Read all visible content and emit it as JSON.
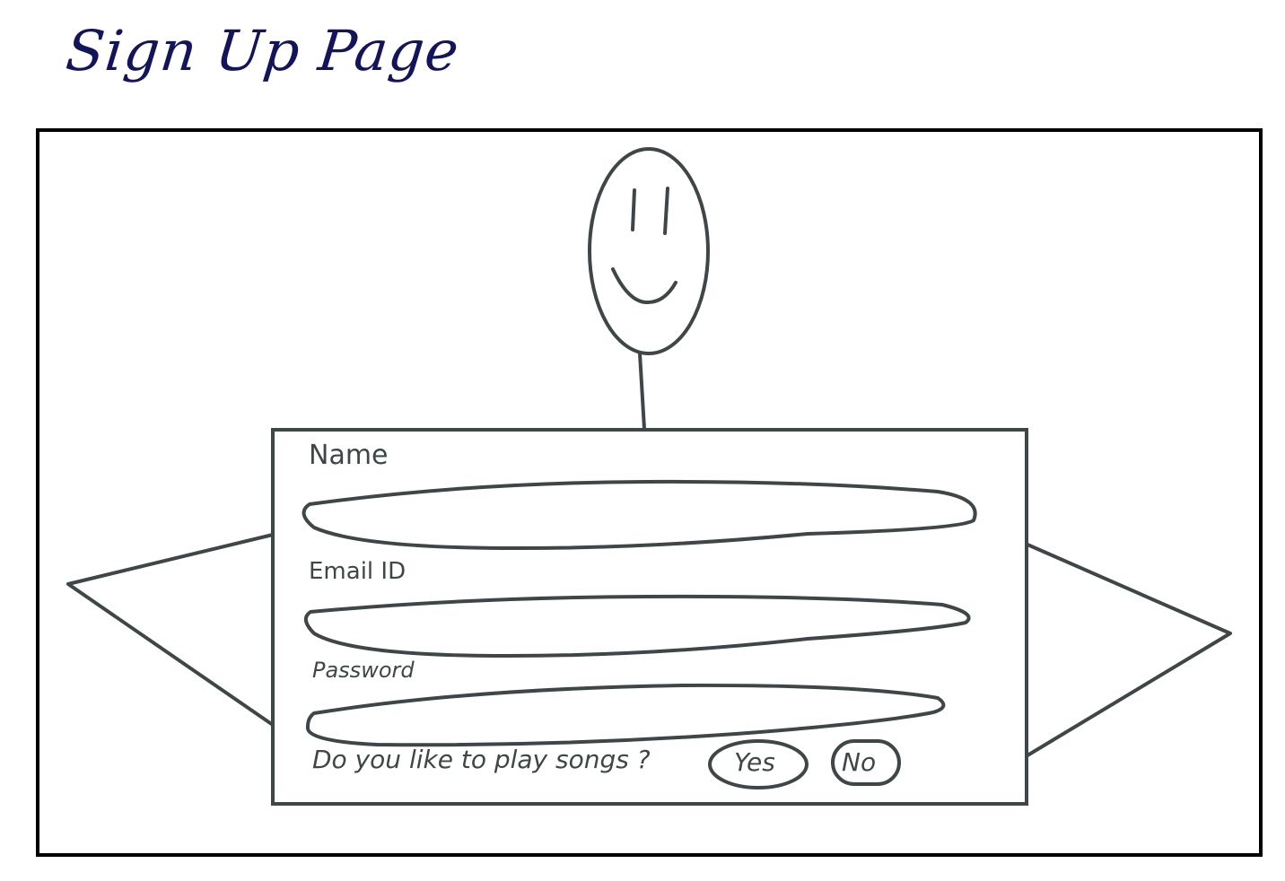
{
  "title": "Sign Up Page",
  "form": {
    "name_label": "Name",
    "email_label": "Email ID",
    "password_label": "Password",
    "question": "Do you like to play songs ?",
    "yes_label": "Yes",
    "no_label": "No"
  },
  "colors": {
    "title": "#14145a",
    "stroke": "#3f4647",
    "frame": "#000000"
  }
}
